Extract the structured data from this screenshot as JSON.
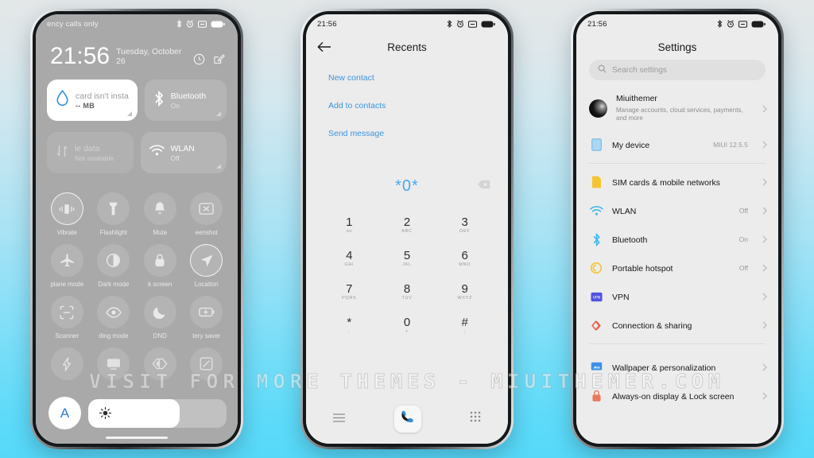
{
  "meta": {
    "watermark": "VISIT FOR MORE THEMES - MIUITHEMER.COM",
    "accent_blue": "#3d93e0",
    "dialer_blue": "#4aa8ef",
    "control_center_bg": "#a9a9a9",
    "screen_bg": "#ececec",
    "page_gradient_top": "#e3e7e8",
    "page_gradient_bottom": "#56d9f9"
  },
  "phone1": {
    "statusbar": {
      "carrier": "ency calls only",
      "time": "",
      "icons": [
        "bluetooth-icon",
        "alarm-icon",
        "silent-icon",
        "battery-icon"
      ]
    },
    "clock": {
      "time": "21:56",
      "date": "Tuesday, October 26",
      "icons": [
        "settings-gear-icon",
        "edit-icon"
      ]
    },
    "big_tiles": [
      {
        "name": "data-usage-tile",
        "icon": "water-drop-icon",
        "title": "card isn't insta",
        "subtitle": "-- MB",
        "state": "on"
      },
      {
        "name": "bluetooth-tile",
        "icon": "bluetooth-icon",
        "title": "Bluetooth",
        "subtitle": "On",
        "state": "default"
      },
      {
        "name": "mobile-data-tile",
        "icon": "data-arrows-icon",
        "title": "le data",
        "subtitle": "Not available",
        "state": "disabled"
      },
      {
        "name": "wlan-tile",
        "icon": "wifi-icon",
        "title": "WLAN",
        "subtitle": "Off",
        "state": "default"
      }
    ],
    "toggles": [
      {
        "label": "Vibrate",
        "icon": "vibrate-icon",
        "active": true
      },
      {
        "label": "Flashlight",
        "icon": "flashlight-icon",
        "active": false
      },
      {
        "label": "Mute",
        "icon": "bell-icon",
        "active": false
      },
      {
        "label": "eenshot",
        "icon": "screenshot-icon",
        "active": false
      },
      {
        "label": "plane mode",
        "icon": "airplane-icon",
        "active": false
      },
      {
        "label": "Dark mode",
        "icon": "contrast-icon",
        "active": false
      },
      {
        "label": "k screen",
        "icon": "lock-icon",
        "active": false
      },
      {
        "label": "Location",
        "icon": "location-arrow-icon",
        "active": true
      },
      {
        "label": "Scanner",
        "icon": "scan-frame-icon",
        "active": false
      },
      {
        "label": "ding mode",
        "icon": "eye-icon",
        "active": false
      },
      {
        "label": "DND",
        "icon": "moon-icon",
        "active": false
      },
      {
        "label": "tery saver",
        "icon": "battery-plus-icon",
        "active": false
      },
      {
        "label": "",
        "icon": "bolt-icon",
        "active": false
      },
      {
        "label": "",
        "icon": "cast-icon",
        "active": false
      },
      {
        "label": "",
        "icon": "color-invert-icon",
        "active": false
      },
      {
        "label": "",
        "icon": "rotate-lock-icon",
        "active": false
      }
    ],
    "brightness": {
      "auto_label": "A",
      "icon": "sun-icon",
      "level_percent": 66
    }
  },
  "phone2": {
    "statusbar": {
      "time": "21:56",
      "icons": [
        "bluetooth-icon",
        "alarm-icon",
        "silent-icon",
        "battery-icon"
      ]
    },
    "header": {
      "back_icon": "arrow-left-icon",
      "title": "Recents"
    },
    "actions": [
      "New contact",
      "Add to contacts",
      "Send message"
    ],
    "dialed_number": "*0*",
    "backspace_icon": "backspace-icon",
    "keypad": [
      {
        "digit": "1",
        "sub": "oo"
      },
      {
        "digit": "2",
        "sub": "ABC"
      },
      {
        "digit": "3",
        "sub": "DEF"
      },
      {
        "digit": "4",
        "sub": "GHI"
      },
      {
        "digit": "5",
        "sub": "JKL"
      },
      {
        "digit": "6",
        "sub": "MNO"
      },
      {
        "digit": "7",
        "sub": "PQRS"
      },
      {
        "digit": "8",
        "sub": "TUV"
      },
      {
        "digit": "9",
        "sub": "WXYZ"
      },
      {
        "digit": "*",
        "sub": ","
      },
      {
        "digit": "0",
        "sub": "+"
      },
      {
        "digit": "#",
        "sub": ";"
      }
    ],
    "nav": {
      "menu_icon": "hamburger-menu-icon",
      "call_icon": "phone-handset-icon",
      "keypad_icon": "dialpad-icon"
    }
  },
  "phone3": {
    "statusbar": {
      "time": "21:56",
      "icons": [
        "bluetooth-icon",
        "alarm-icon",
        "silent-icon",
        "battery-icon"
      ]
    },
    "title": "Settings",
    "search": {
      "placeholder": "Search settings",
      "icon": "search-icon"
    },
    "account": {
      "name": "Miuithemer",
      "desc": "Manage accounts, cloud services, payments, and more",
      "avatar": "account-avatar"
    },
    "items": [
      {
        "name": "My device",
        "value": "MIUI 12.5.5",
        "icon": "device-icon",
        "color": "#a9d8f5"
      },
      {
        "name": "SIM cards & mobile networks",
        "value": "",
        "icon": "sim-card-icon",
        "color": "#f5c431"
      },
      {
        "name": "WLAN",
        "value": "Off",
        "icon": "wifi-icon",
        "color": "#3bb4e8"
      },
      {
        "name": "Bluetooth",
        "value": "On",
        "icon": "bluetooth-icon",
        "color": "#3bb4e8"
      },
      {
        "name": "Portable hotspot",
        "value": "Off",
        "icon": "hotspot-icon",
        "color": "#f5c431"
      },
      {
        "name": "VPN",
        "value": "",
        "icon": "vpn-icon",
        "color": "#5252e0"
      },
      {
        "name": "Connection & sharing",
        "value": "",
        "icon": "sharing-icon",
        "color": "#e8604c"
      },
      {
        "name": "Wallpaper & personalization",
        "value": "",
        "icon": "wallpaper-icon",
        "color": "#3b8fe8"
      },
      {
        "name": "Always-on display & Lock screen",
        "value": "",
        "icon": "lock-icon",
        "color": "#e8785c"
      }
    ]
  }
}
